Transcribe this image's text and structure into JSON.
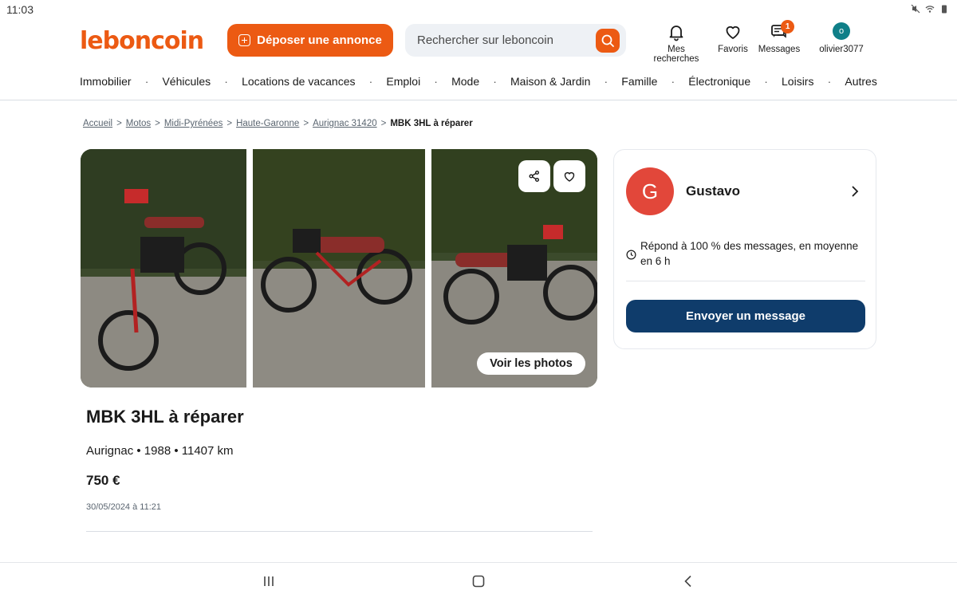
{
  "status_bar": {
    "time": "11:03"
  },
  "header": {
    "logo": "leboncoin",
    "post_button": "Déposer une annonce",
    "search_placeholder": "Rechercher sur leboncoin",
    "nav": {
      "searches": "Mes recherches",
      "favorites": "Favoris",
      "messages": "Messages",
      "messages_badge": "1",
      "user": "olivier3077",
      "user_initial": "o"
    }
  },
  "categories": [
    "Immobilier",
    "Véhicules",
    "Locations de vacances",
    "Emploi",
    "Mode",
    "Maison & Jardin",
    "Famille",
    "Électronique",
    "Loisirs",
    "Autres"
  ],
  "breadcrumb": {
    "items": [
      "Accueil",
      "Motos",
      "Midi-Pyrénées",
      "Haute-Garonne",
      "Aurignac 31420"
    ],
    "current": "MBK 3HL à réparer"
  },
  "gallery": {
    "see_photos": "Voir les photos"
  },
  "ad": {
    "title": "MBK 3HL à réparer",
    "meta": "Aurignac • 1988 • 11407 km",
    "price": "750 €",
    "date": "30/05/2024 à 11:21"
  },
  "seller": {
    "initial": "G",
    "name": "Gustavo",
    "response": "Répond à 100 % des messages, en moyenne en 6 h",
    "message_button": "Envoyer un message"
  },
  "colors": {
    "brand": "#ec5a13",
    "primary_button": "#0f3c6b",
    "seller_avatar": "#e2473a",
    "user_avatar": "#0f7f88"
  }
}
